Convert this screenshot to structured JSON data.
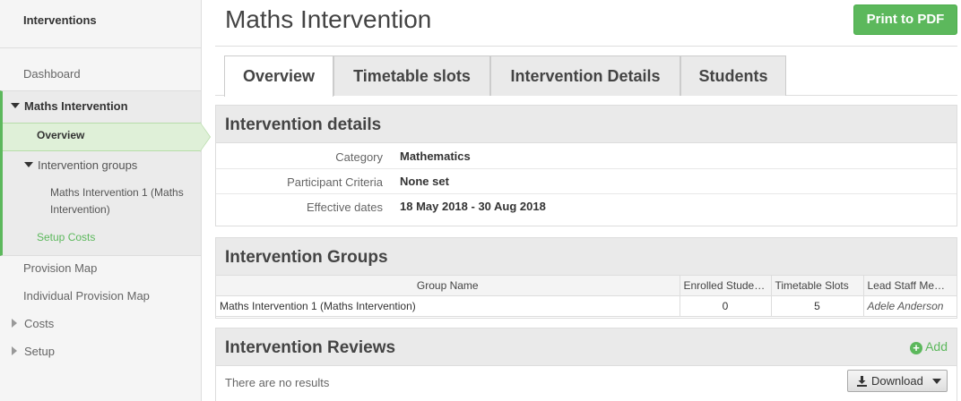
{
  "sidebar": {
    "title": "Interventions",
    "dashboard": "Dashboard",
    "current": "Maths Intervention",
    "overview": "Overview",
    "groups_label": "Intervention groups",
    "group_line1": "Maths Intervention 1 (Maths",
    "group_line2": "Intervention)",
    "setup_costs": "Setup Costs",
    "provision_map": "Provision Map",
    "individual_map": "Individual Provision Map",
    "costs": "Costs",
    "setup": "Setup"
  },
  "header": {
    "title": "Maths Intervention",
    "print_label": "Print to PDF"
  },
  "tabs": [
    {
      "label": "Overview"
    },
    {
      "label": "Timetable slots"
    },
    {
      "label": "Intervention Details"
    },
    {
      "label": "Students"
    }
  ],
  "details": {
    "heading": "Intervention details",
    "rows": [
      {
        "label": "Category",
        "value": "Mathematics"
      },
      {
        "label": "Participant Criteria",
        "value": "None set"
      },
      {
        "label": "Effective dates",
        "value": "18 May 2018 - 30 Aug 2018"
      }
    ]
  },
  "groups": {
    "heading": "Intervention Groups",
    "columns": [
      "Group Name",
      "Enrolled Students",
      "Timetable Slots",
      "Lead Staff Member"
    ],
    "rows": [
      {
        "name": "Maths Intervention 1 (Maths Intervention)",
        "enrolled": "0",
        "slots": "5",
        "lead": "Adele Anderson"
      }
    ]
  },
  "reviews": {
    "heading": "Intervention Reviews",
    "add_label": "Add",
    "empty_text": "There are no results",
    "download_label": "Download"
  },
  "colors": {
    "accent": "#5cb85c",
    "active_bg": "#dff0d8"
  }
}
